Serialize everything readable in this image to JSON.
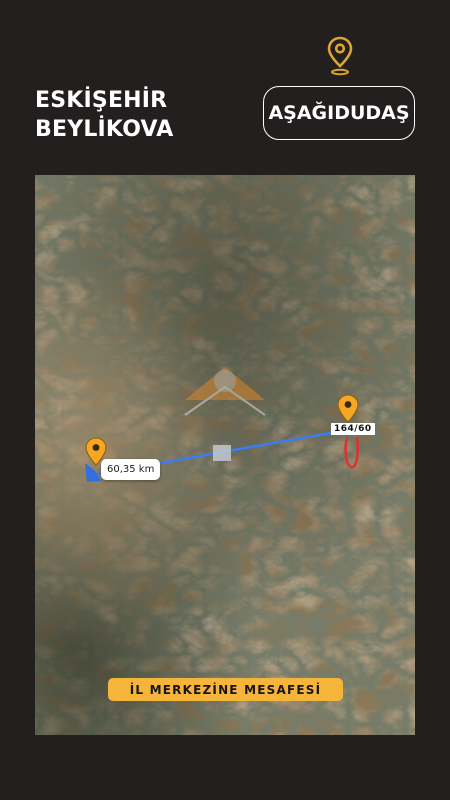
{
  "header": {
    "city": "ESKİŞEHİR",
    "district": "BEYLİKOVA",
    "village": "AŞAĞIDUDAŞ",
    "location_icon": "map-pin-icon"
  },
  "map": {
    "distance_label": "60,35 km",
    "parcel_label": "164/60",
    "caption": "İL MERKEZİNE MESAFESİ",
    "route_color": "#3b7cf0",
    "pin_color": "#f5a623",
    "caption_color": "#f5b43a",
    "parcel_outline_color": "#e03030"
  },
  "colors": {
    "background": "#231f1e",
    "text": "#ffffff"
  }
}
